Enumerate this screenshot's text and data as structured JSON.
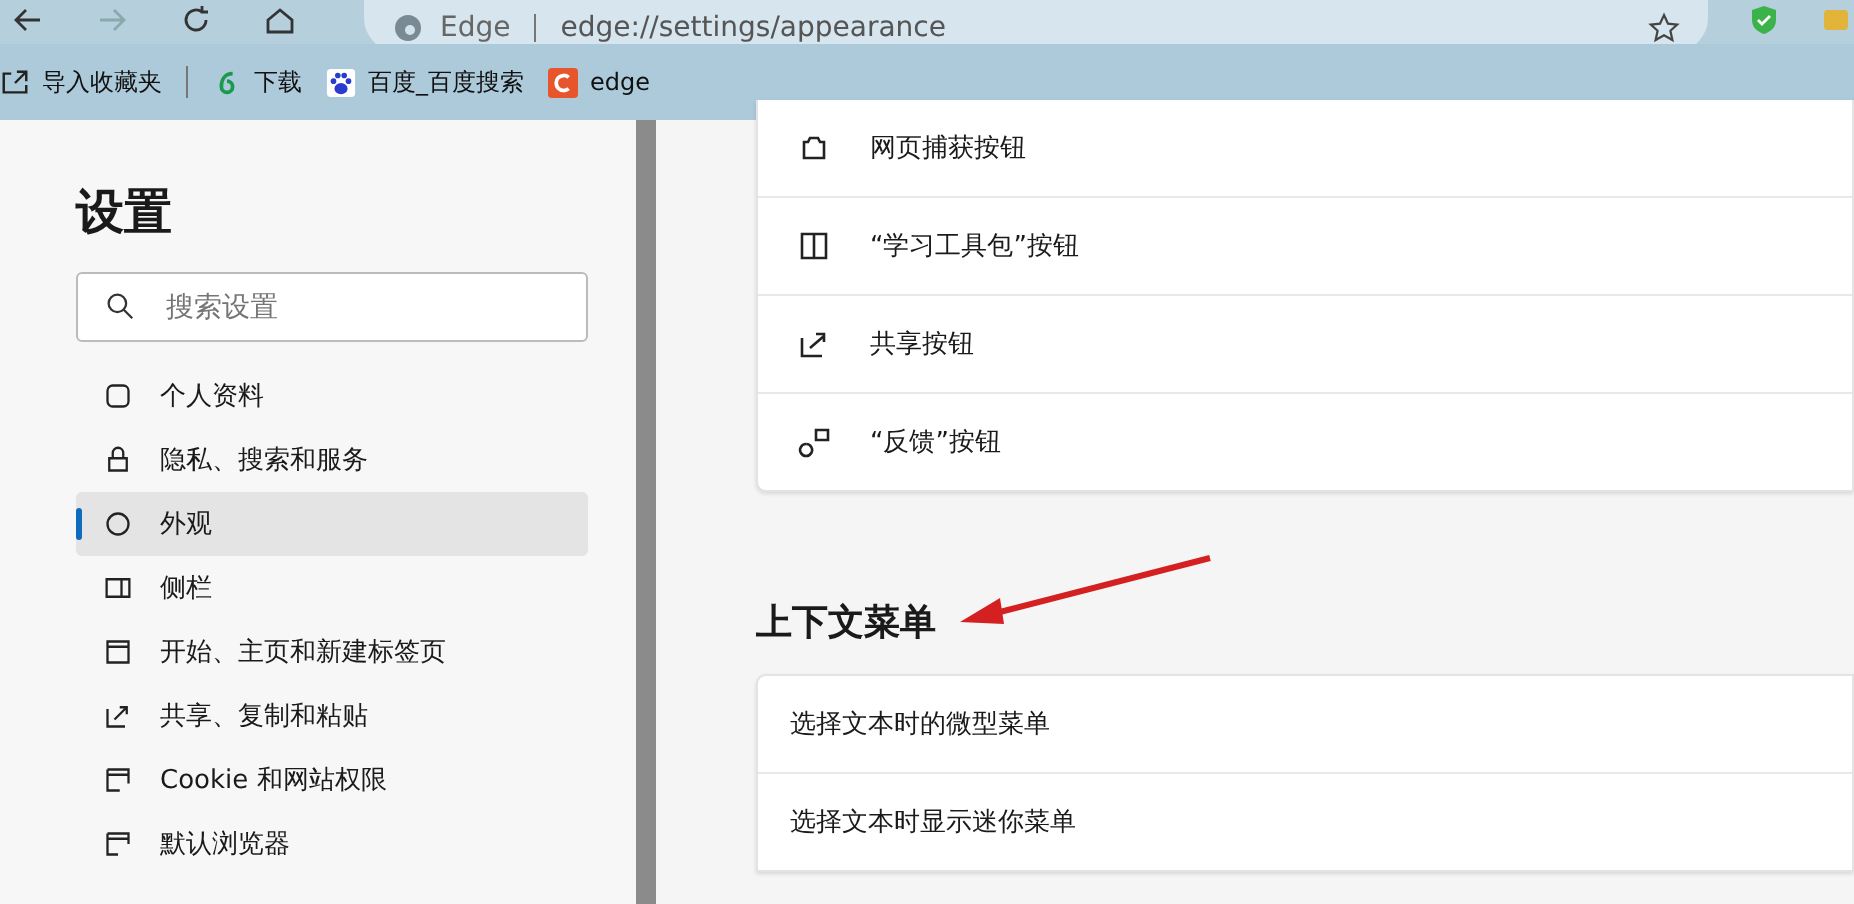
{
  "toolbar": {
    "site_label": "Edge",
    "address": "edge://settings/appearance"
  },
  "bookmarks": [
    {
      "label": "导入收藏夹"
    },
    {
      "label": "下载"
    },
    {
      "label": "百度_百度搜索"
    },
    {
      "label": "edge"
    }
  ],
  "sidebar": {
    "title": "设置",
    "search": {
      "placeholder": "搜索设置"
    },
    "items": [
      {
        "label": "个人资料",
        "selected": false
      },
      {
        "label": "隐私、搜索和服务",
        "selected": false
      },
      {
        "label": "外观",
        "selected": true
      },
      {
        "label": "侧栏",
        "selected": false
      },
      {
        "label": "开始、主页和新建标签页",
        "selected": false
      },
      {
        "label": "共享、复制和粘贴",
        "selected": false
      },
      {
        "label": "Cookie 和网站权限",
        "selected": false
      },
      {
        "label": "默认浏览器",
        "selected": false
      }
    ]
  },
  "toolbar_buttons_card": {
    "rows": [
      {
        "label": "网页捕获按钮"
      },
      {
        "label": "“学习工具包”按钮"
      },
      {
        "label": "共享按钮"
      },
      {
        "label": "“反馈”按钮"
      }
    ]
  },
  "context_menu": {
    "title": "上下文菜单",
    "rows": [
      {
        "label": "选择文本时的微型菜单"
      },
      {
        "label": "选择文本时显示迷你菜单"
      }
    ]
  }
}
